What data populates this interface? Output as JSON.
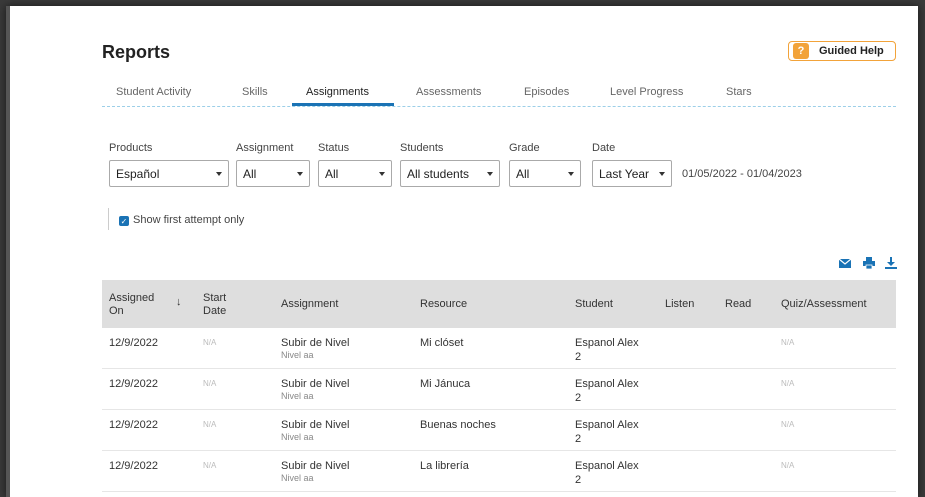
{
  "page": {
    "title": "Reports"
  },
  "help": {
    "label": "Guided Help",
    "icon": "question-icon",
    "icon_glyph": "?"
  },
  "tabs": [
    {
      "label": "Student Activity"
    },
    {
      "label": "Skills"
    },
    {
      "label": "Assignments",
      "active": true
    },
    {
      "label": "Assessments"
    },
    {
      "label": "Episodes"
    },
    {
      "label": "Level Progress"
    },
    {
      "label": "Stars"
    }
  ],
  "filters": {
    "products": {
      "label": "Products",
      "value": "Español"
    },
    "assignment": {
      "label": "Assignment",
      "value": "All"
    },
    "status": {
      "label": "Status",
      "value": "All"
    },
    "students": {
      "label": "Students",
      "value": "All students"
    },
    "grade": {
      "label": "Grade",
      "value": "All"
    },
    "date": {
      "label": "Date",
      "value": "Last Year"
    },
    "date_range": "01/05/2022 - 01/04/2023"
  },
  "show_first_attempt": {
    "label": "Show first attempt only",
    "checked": true
  },
  "toolbar": {
    "icons": [
      "email-icon",
      "print-icon",
      "download-icon"
    ]
  },
  "table": {
    "headers": {
      "assigned_on": "Assigned On",
      "start_date": "Start Date",
      "assignment": "Assignment",
      "resource": "Resource",
      "student": "Student",
      "listen": "Listen",
      "read": "Read",
      "quiz": "Quiz/Assessment"
    },
    "rows": [
      {
        "assigned_on": "12/9/2022",
        "start_date": "N/A",
        "assignment": "Subir de Nivel",
        "assignment_sub": "Nivel aa",
        "resource": "Mi clóset",
        "student": "Espanol Alex",
        "student_sub": "2",
        "quiz": "N/A"
      },
      {
        "assigned_on": "12/9/2022",
        "start_date": "N/A",
        "assignment": "Subir de Nivel",
        "assignment_sub": "Nivel aa",
        "resource": "Mi Jánuca",
        "student": "Espanol Alex",
        "student_sub": "2",
        "quiz": "N/A"
      },
      {
        "assigned_on": "12/9/2022",
        "start_date": "N/A",
        "assignment": "Subir de Nivel",
        "assignment_sub": "Nivel aa",
        "resource": "Buenas noches",
        "student": "Espanol Alex",
        "student_sub": "2",
        "quiz": "N/A"
      },
      {
        "assigned_on": "12/9/2022",
        "start_date": "N/A",
        "assignment": "Subir de Nivel",
        "assignment_sub": "Nivel aa",
        "resource": "La librería",
        "student": "Espanol Alex",
        "student_sub": "2",
        "quiz": "N/A"
      }
    ]
  },
  "colors": {
    "accent": "#1a73b5",
    "help": "#f2a33a",
    "arrow": "#cc0000",
    "header_bg": "#dedede"
  }
}
